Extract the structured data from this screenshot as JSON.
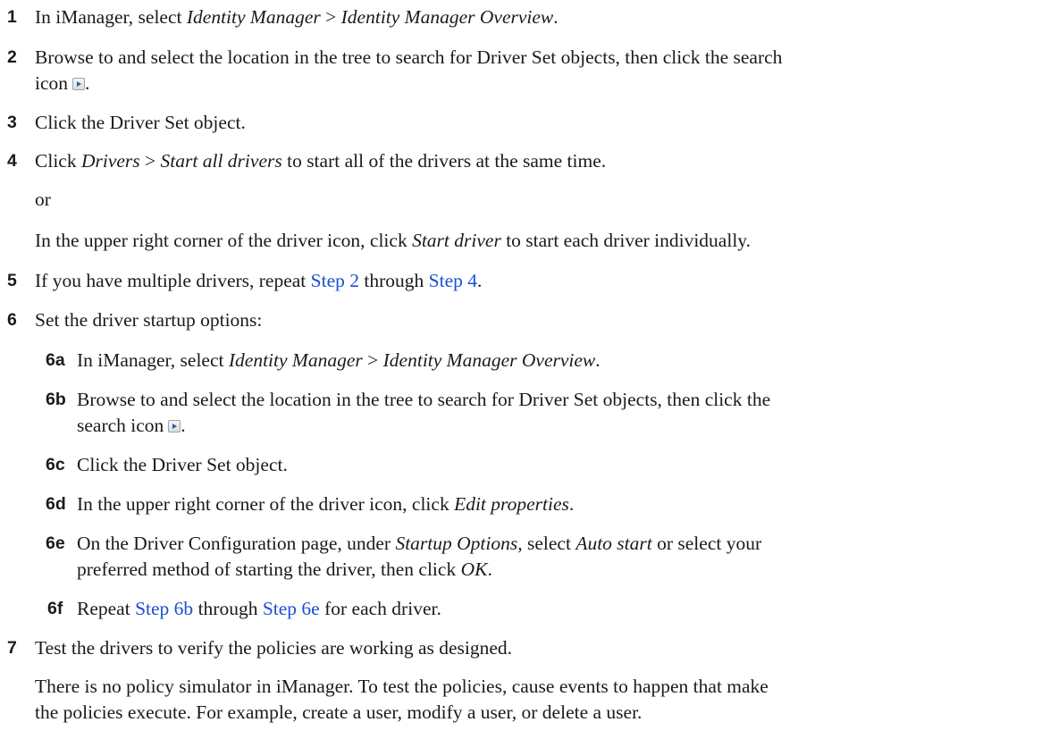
{
  "steps": {
    "s1": {
      "num": "1",
      "pre": "In iManager, select ",
      "em1": "Identity Manager",
      "sep": " > ",
      "em2": "Identity Manager Overview",
      "post": "."
    },
    "s2": {
      "num": "2",
      "line1": "Browse to and select the location in the tree to search for Driver Set objects, then click the search",
      "line2_pre": "icon",
      "line2_post": "."
    },
    "s3": {
      "num": "3",
      "text": "Click the Driver Set object."
    },
    "s4": {
      "num": "4",
      "pre": "Click ",
      "em1": "Drivers",
      "sep": " > ",
      "em2": "Start all drivers",
      "post": " to start all of the drivers at the same time.",
      "or": "or",
      "alt_pre": "In the upper right corner of the driver icon, click ",
      "alt_em": "Start driver",
      "alt_post": " to start each driver individually."
    },
    "s5": {
      "num": "5",
      "pre": "If you have multiple drivers, repeat ",
      "link1": "Step 2",
      "mid": " through ",
      "link2": "Step 4",
      "post": "."
    },
    "s6": {
      "num": "6",
      "text": "Set the driver startup options:",
      "sub": {
        "a": {
          "num": "6a",
          "pre": "In iManager, select ",
          "em1": "Identity Manager",
          "sep": " > ",
          "em2": "Identity Manager Overview",
          "post": "."
        },
        "b": {
          "num": "6b",
          "line1": "Browse to and select the location in the tree to search for Driver Set objects, then click the",
          "line2_pre": "search icon",
          "line2_post": "."
        },
        "c": {
          "num": "6c",
          "text": "Click the Driver Set object."
        },
        "d": {
          "num": "6d",
          "pre": "In the upper right corner of the driver icon, click ",
          "em": "Edit properties",
          "post": "."
        },
        "e": {
          "num": "6e",
          "pre": "On the Driver Configuration page, under ",
          "em1": "Startup Options",
          "mid": ", select ",
          "em2": "Auto start",
          "post1": " or select your",
          "line2_pre": "preferred method of starting the driver, then click ",
          "em3": "OK",
          "line2_post": "."
        },
        "f": {
          "num": "6f",
          "pre": "Repeat ",
          "link1": "Step 6b",
          "mid": " through ",
          "link2": "Step 6e",
          "post": " for each driver."
        }
      }
    },
    "s7": {
      "num": "7",
      "text": "Test the drivers to verify the policies are working as designed.",
      "p_line1": "There is no policy simulator in iManager. To test the policies, cause events to happen that make",
      "p_line2": "the policies execute. For example, create a user, modify a user, or delete a user."
    }
  },
  "colors": {
    "link": "#1a4fd0",
    "text": "#1a1a1a"
  }
}
